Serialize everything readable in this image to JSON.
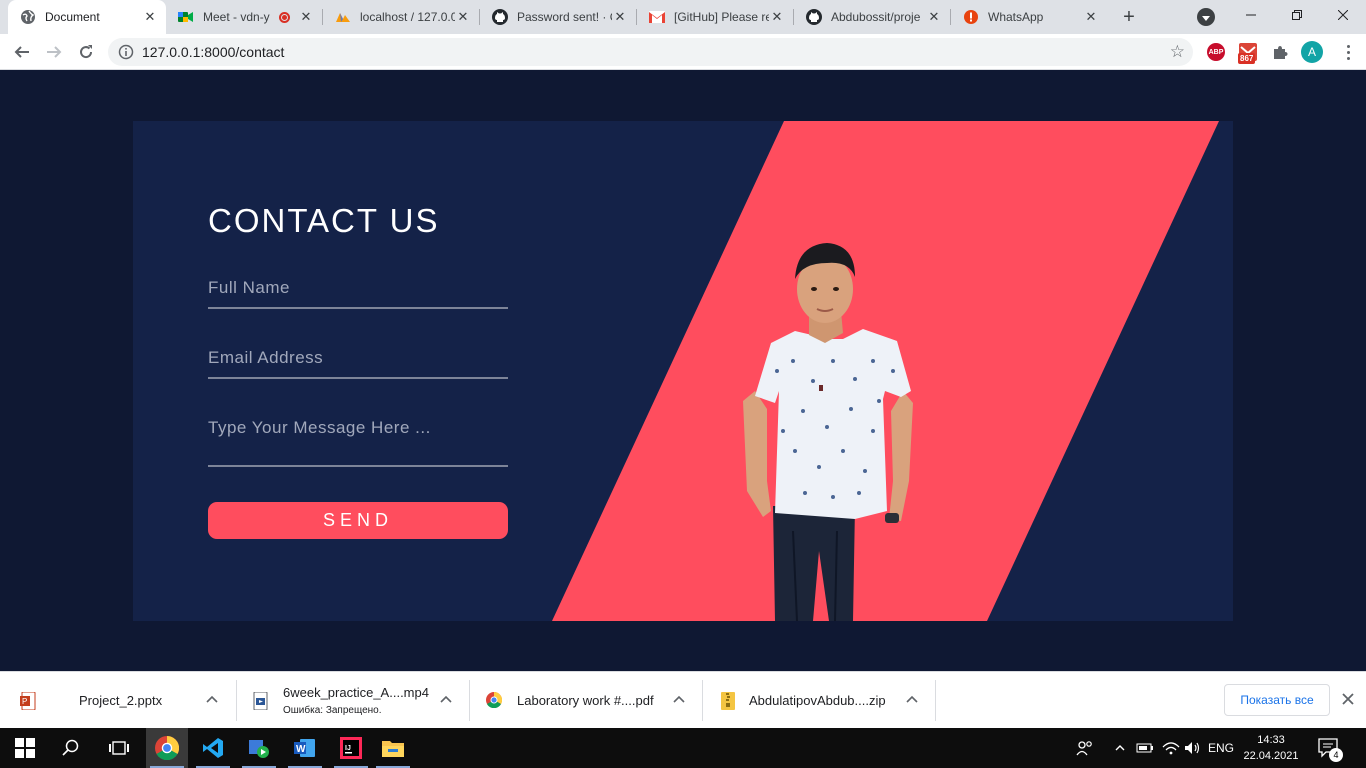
{
  "browser": {
    "tabs": [
      {
        "title": "Document",
        "icon": "globe-icon",
        "active": true
      },
      {
        "title": "Meet - vdn-y",
        "icon": "google-meet-icon",
        "recording": true
      },
      {
        "title": "localhost / 127.0.0",
        "icon": "phpmyadmin-icon"
      },
      {
        "title": "Password sent! · G",
        "icon": "github-icon"
      },
      {
        "title": "[GitHub] Please re",
        "icon": "gmail-icon"
      },
      {
        "title": "Abdubossit/proje",
        "icon": "github-icon"
      },
      {
        "title": "WhatsApp",
        "icon": "alert-icon"
      }
    ],
    "new_tab_label": "+",
    "url": "127.0.0.1:8000/contact",
    "extensions": {
      "abp_label": "ABP",
      "mail_badge": "867",
      "profile_initial": "A"
    }
  },
  "page": {
    "heading": "CONTACT US",
    "fields": {
      "full_name_placeholder": "Full Name",
      "email_placeholder": "Email Address",
      "message_placeholder": "Type Your Message Here ..."
    },
    "send_label": "SEND",
    "colors": {
      "page_bg": "#0f1833",
      "card_bg": "#142248",
      "accent": "#ff4d5e"
    }
  },
  "downloads": {
    "items": [
      {
        "name": "Project_2.pptx",
        "status": "",
        "icon": "powerpoint-file-icon"
      },
      {
        "name": "6week_practice_A....mp4",
        "status": "Ошибка: Запрещено.",
        "icon": "video-file-icon"
      },
      {
        "name": "Laboratory work #....pdf",
        "status": "",
        "icon": "chrome-pdf-icon"
      },
      {
        "name": "AbdulatipovAbdub....zip",
        "status": "",
        "icon": "zip-file-icon"
      }
    ],
    "show_all_label": "Показать все"
  },
  "taskbar": {
    "apps": [
      "start-icon",
      "search-icon",
      "task-view-icon",
      "chrome-icon",
      "vscode-icon",
      "media-player-icon",
      "word-icon",
      "intellij-icon",
      "file-explorer-icon"
    ],
    "language": "ENG",
    "time": "14:33",
    "date": "22.04.2021",
    "notification_count": "4"
  }
}
